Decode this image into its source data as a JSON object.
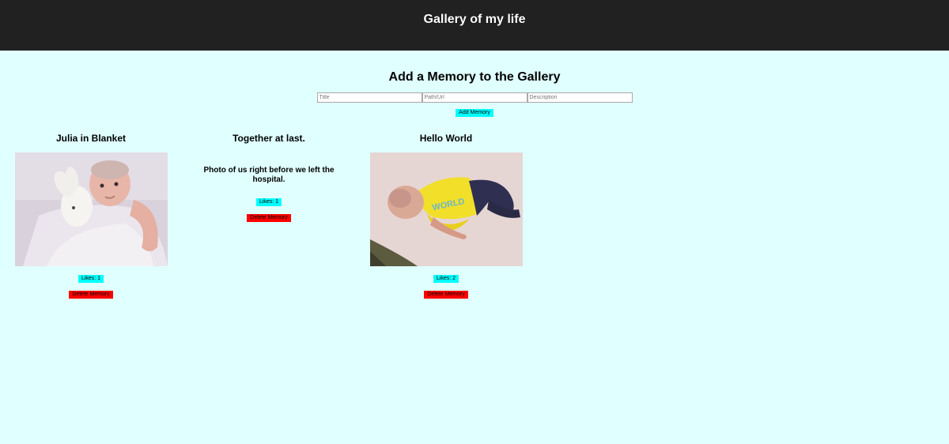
{
  "header": {
    "title": "Gallery of my life"
  },
  "add_form": {
    "heading": "Add a Memory to the Gallery",
    "title_placeholder": "Title",
    "path_placeholder": "Path/Url",
    "description_placeholder": "Description",
    "add_button_label": "Add Memory"
  },
  "memories": [
    {
      "title": "Julia in Blanket",
      "likes_label": "Likes: 1",
      "delete_label": "Delete Memory"
    },
    {
      "title": "Together at last.",
      "description": "Photo of us right before we left the hospital.",
      "likes_label": "Likes: 1",
      "delete_label": "Delete Memory"
    },
    {
      "title": "Hello World",
      "likes_label": "Likes: 2",
      "delete_label": "Delete Memory"
    }
  ],
  "colors": {
    "header_bg": "#212121",
    "page_bg": "#e0ffff",
    "like_button": "#00ffff",
    "delete_button": "#ff0000"
  }
}
